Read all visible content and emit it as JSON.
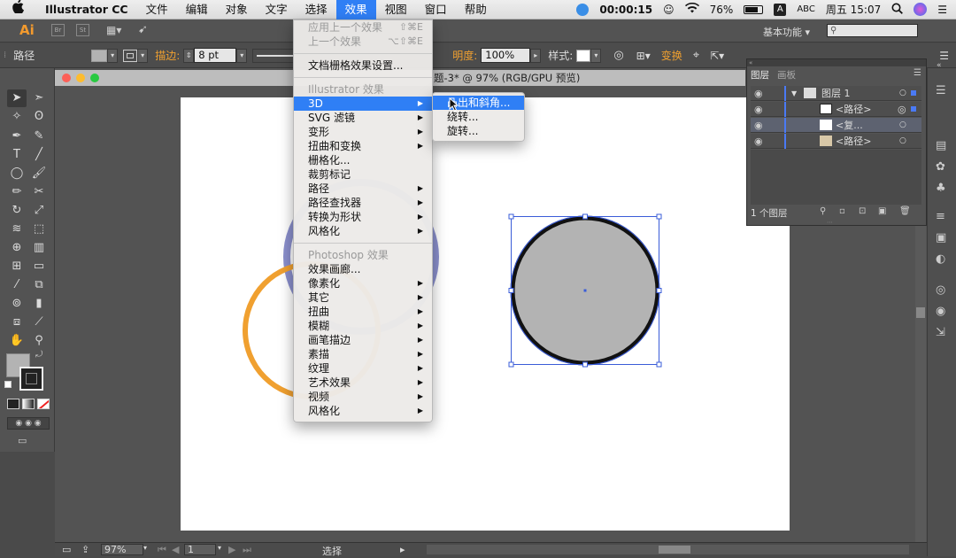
{
  "menubar": {
    "apple": "",
    "items": [
      "Illustrator CC",
      "文件",
      "编辑",
      "对象",
      "文字",
      "选择",
      "效果",
      "视图",
      "窗口",
      "帮助"
    ],
    "active_index": 6,
    "timer": "00:00:15",
    "battery": "76%",
    "input_badge": "A",
    "input": "ABC",
    "clock": "周五 15:07"
  },
  "appbar": {
    "logo": "Ai",
    "workspace": "基本功能"
  },
  "control": {
    "selection_label": "路径",
    "stroke_label": "描边:",
    "stroke_value": "8 pt",
    "opacity_label": "明度:",
    "opacity_value": "100%",
    "style_label": "样式:",
    "transform_label": "变换"
  },
  "document": {
    "title_suffix": "题-3* @ 97% (RGB/GPU 预览)"
  },
  "menu_effect": {
    "rows": [
      {
        "label": "应用上一个效果",
        "shortcut": "⇧⌘E",
        "state": "disabled"
      },
      {
        "label": "上一个效果",
        "shortcut": "⌥⇧⌘E",
        "state": "disabled"
      },
      {
        "sep": true
      },
      {
        "label": "文档栅格效果设置...",
        "state": "normal"
      },
      {
        "sep": true
      },
      {
        "label": "Illustrator 效果",
        "state": "header"
      },
      {
        "label": "3D",
        "state": "highlight",
        "submenu": true
      },
      {
        "label": "SVG 滤镜",
        "state": "normal",
        "submenu": true
      },
      {
        "label": "变形",
        "state": "normal",
        "submenu": true
      },
      {
        "label": "扭曲和变换",
        "state": "normal",
        "submenu": true
      },
      {
        "label": "栅格化...",
        "state": "normal"
      },
      {
        "label": "裁剪标记",
        "state": "normal"
      },
      {
        "label": "路径",
        "state": "normal",
        "submenu": true
      },
      {
        "label": "路径查找器",
        "state": "normal",
        "submenu": true
      },
      {
        "label": "转换为形状",
        "state": "normal",
        "submenu": true
      },
      {
        "label": "风格化",
        "state": "normal",
        "submenu": true
      },
      {
        "sep": true
      },
      {
        "label": "Photoshop 效果",
        "state": "header"
      },
      {
        "label": "效果画廊...",
        "state": "normal"
      },
      {
        "label": "像素化",
        "state": "normal",
        "submenu": true
      },
      {
        "label": "其它",
        "state": "normal",
        "submenu": true
      },
      {
        "label": "扭曲",
        "state": "normal",
        "submenu": true
      },
      {
        "label": "模糊",
        "state": "normal",
        "submenu": true
      },
      {
        "label": "画笔描边",
        "state": "normal",
        "submenu": true
      },
      {
        "label": "素描",
        "state": "normal",
        "submenu": true
      },
      {
        "label": "纹理",
        "state": "normal",
        "submenu": true
      },
      {
        "label": "艺术效果",
        "state": "normal",
        "submenu": true
      },
      {
        "label": "视频",
        "state": "normal",
        "submenu": true
      },
      {
        "label": "风格化",
        "state": "normal",
        "submenu": true
      }
    ]
  },
  "menu_3d": {
    "rows": [
      {
        "label": "凸出和斜角...",
        "state": "highlight"
      },
      {
        "label": "绕转...",
        "state": "normal"
      },
      {
        "label": "旋转...",
        "state": "normal"
      }
    ]
  },
  "layers_panel": {
    "tabs": [
      "图层",
      "画板"
    ],
    "rows": [
      "图层 1",
      "<路径>",
      "<复...",
      "<路径>"
    ],
    "footer": "1 个图层"
  },
  "status": {
    "zoom": "97%",
    "page": "1",
    "tool": "选择"
  },
  "colors": {
    "accent": "#2f7ff5",
    "stroke_orange": "#f0a030",
    "circle_fill": "#b3b3b3",
    "circle_stroke": "#111111",
    "selection": "#3a5cd8",
    "purple_circle": "#8a8fcc"
  }
}
